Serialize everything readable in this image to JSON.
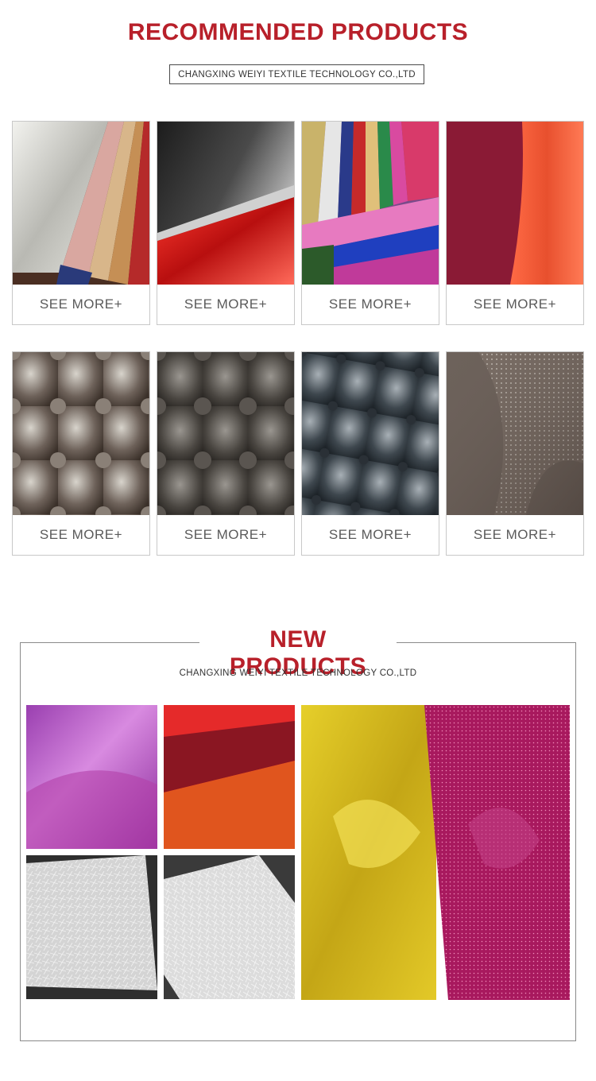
{
  "recommended": {
    "title": "RECOMMENDED PRODUCTS",
    "company": "CHANGXING WEIYI TEXTILE TECHNOLOGY CO.,LTD",
    "cards": [
      {
        "button": "SEE MORE+"
      },
      {
        "button": "SEE MORE+"
      },
      {
        "button": "SEE MORE+"
      },
      {
        "button": "SEE MORE+"
      },
      {
        "button": "SEE MORE+"
      },
      {
        "button": "SEE MORE+"
      },
      {
        "button": "SEE MORE+"
      },
      {
        "button": "SEE MORE+"
      }
    ]
  },
  "new_products": {
    "title": "NEW PRODUCTS",
    "company": "CHANGXING WEIYI TEXTILE TECHNOLOGY CO.,LTD"
  },
  "colors": {
    "title_red": "#b8202a",
    "button_text": "#5a5a5a",
    "border": "#c8c8c8"
  }
}
